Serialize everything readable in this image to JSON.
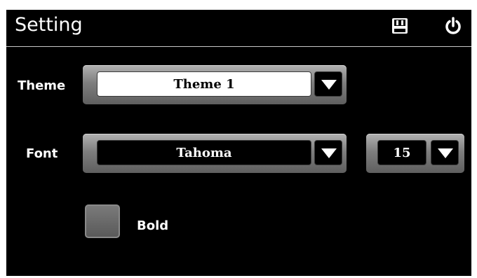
{
  "header": {
    "title": "Setting",
    "icons": [
      "save-icon",
      "power-icon"
    ]
  },
  "theme": {
    "label": "Theme",
    "selected": "Theme 1"
  },
  "font": {
    "label": "Font",
    "selected": "Tahoma",
    "size": "15"
  },
  "bold": {
    "label": "Bold",
    "checked": false
  },
  "colors": {
    "background": "#000000",
    "text": "#ffffff",
    "control_gradient_top": "#b2b2b2",
    "control_gradient_bottom": "#5f5f5f"
  }
}
